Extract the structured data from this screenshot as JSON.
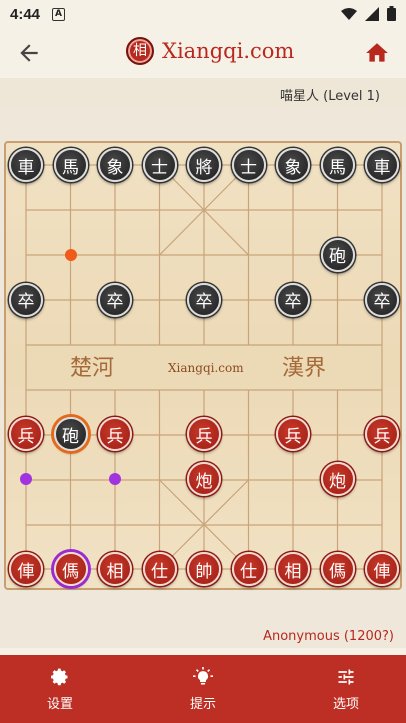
{
  "status_bar": {
    "time": "4:44",
    "notif_letter": "A"
  },
  "header": {
    "logo_char": "相",
    "title": "Xiangqi.com"
  },
  "opponent": {
    "name": "喵星人 (Level 1)"
  },
  "board": {
    "river_left": "楚河",
    "river_right": "漢界",
    "river_site": "Xiangqi.com",
    "pieces": [
      {
        "char": "車",
        "color": "black",
        "col": 0,
        "row": 0
      },
      {
        "char": "馬",
        "color": "black",
        "col": 1,
        "row": 0
      },
      {
        "char": "象",
        "color": "black",
        "col": 2,
        "row": 0
      },
      {
        "char": "士",
        "color": "black",
        "col": 3,
        "row": 0
      },
      {
        "char": "將",
        "color": "black",
        "col": 4,
        "row": 0
      },
      {
        "char": "士",
        "color": "black",
        "col": 5,
        "row": 0
      },
      {
        "char": "象",
        "color": "black",
        "col": 6,
        "row": 0
      },
      {
        "char": "馬",
        "color": "black",
        "col": 7,
        "row": 0
      },
      {
        "char": "車",
        "color": "black",
        "col": 8,
        "row": 0
      },
      {
        "char": "砲",
        "color": "black",
        "col": 7,
        "row": 2
      },
      {
        "char": "卒",
        "color": "black",
        "col": 0,
        "row": 3
      },
      {
        "char": "卒",
        "color": "black",
        "col": 2,
        "row": 3
      },
      {
        "char": "卒",
        "color": "black",
        "col": 4,
        "row": 3
      },
      {
        "char": "卒",
        "color": "black",
        "col": 6,
        "row": 3
      },
      {
        "char": "卒",
        "color": "black",
        "col": 8,
        "row": 3
      },
      {
        "char": "兵",
        "color": "red",
        "col": 0,
        "row": 6
      },
      {
        "char": "砲",
        "color": "black",
        "col": 1,
        "row": 6,
        "state": "last-move"
      },
      {
        "char": "兵",
        "color": "red",
        "col": 2,
        "row": 6
      },
      {
        "char": "兵",
        "color": "red",
        "col": 4,
        "row": 6
      },
      {
        "char": "兵",
        "color": "red",
        "col": 6,
        "row": 6
      },
      {
        "char": "兵",
        "color": "red",
        "col": 8,
        "row": 6
      },
      {
        "char": "炮",
        "color": "red",
        "col": 4,
        "row": 7
      },
      {
        "char": "炮",
        "color": "red",
        "col": 7,
        "row": 7
      },
      {
        "char": "俥",
        "color": "red",
        "col": 0,
        "row": 9
      },
      {
        "char": "傌",
        "color": "red",
        "col": 1,
        "row": 9,
        "state": "selected"
      },
      {
        "char": "相",
        "color": "red",
        "col": 2,
        "row": 9
      },
      {
        "char": "仕",
        "color": "red",
        "col": 3,
        "row": 9
      },
      {
        "char": "帥",
        "color": "red",
        "col": 4,
        "row": 9
      },
      {
        "char": "仕",
        "color": "red",
        "col": 5,
        "row": 9
      },
      {
        "char": "相",
        "color": "red",
        "col": 6,
        "row": 9
      },
      {
        "char": "傌",
        "color": "red",
        "col": 7,
        "row": 9
      },
      {
        "char": "俥",
        "color": "red",
        "col": 8,
        "row": 9
      }
    ],
    "markers": [
      {
        "type": "last-move-origin",
        "color": "orange",
        "col": 1,
        "row": 2
      },
      {
        "type": "move-hint",
        "color": "purple",
        "col": 0,
        "row": 7
      },
      {
        "type": "move-hint",
        "color": "purple",
        "col": 2,
        "row": 7
      }
    ]
  },
  "self": {
    "name": "Anonymous (1200?)"
  },
  "bottom_nav": [
    {
      "label": "设置",
      "icon": "gear-icon"
    },
    {
      "label": "提示",
      "icon": "lightbulb-icon"
    },
    {
      "label": "选项",
      "icon": "sliders-icon"
    }
  ],
  "colors": {
    "brand_red": "#bd2f24",
    "last_move": "#f05a1a",
    "hint": "#a234e0"
  }
}
